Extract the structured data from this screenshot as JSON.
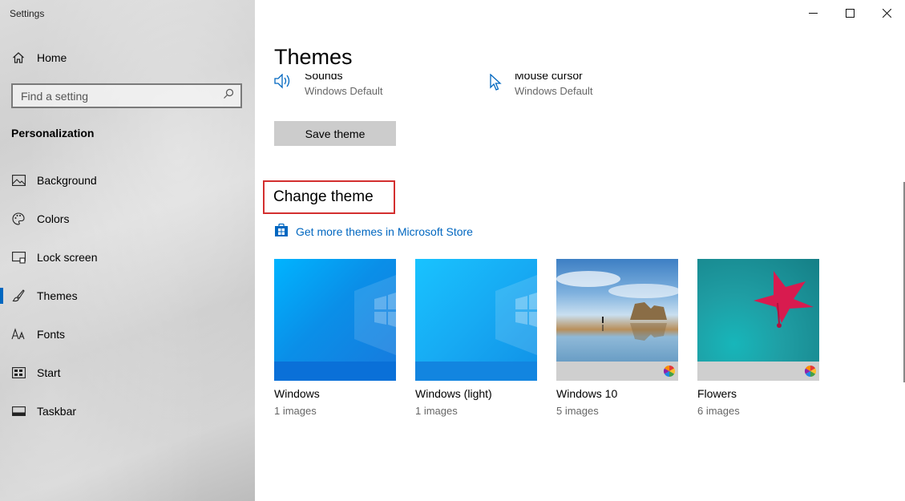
{
  "app": {
    "title": "Settings"
  },
  "sidebar": {
    "home_label": "Home",
    "search_placeholder": "Find a setting",
    "section_title": "Personalization",
    "items": [
      {
        "label": "Background",
        "icon": "picture-icon"
      },
      {
        "label": "Colors",
        "icon": "palette-icon"
      },
      {
        "label": "Lock screen",
        "icon": "lock-screen-icon"
      },
      {
        "label": "Themes",
        "icon": "brush-icon",
        "active": true
      },
      {
        "label": "Fonts",
        "icon": "font-icon"
      },
      {
        "label": "Start",
        "icon": "start-icon"
      },
      {
        "label": "Taskbar",
        "icon": "taskbar-icon"
      }
    ]
  },
  "main": {
    "title": "Themes",
    "properties": [
      {
        "name": "Sounds",
        "value": "Windows Default",
        "icon": "speaker-icon"
      },
      {
        "name": "Mouse cursor",
        "value": "Windows Default",
        "icon": "cursor-icon"
      }
    ],
    "save_button": "Save theme",
    "change_theme_heading": "Change theme",
    "store_link": "Get more themes in Microsoft Store",
    "themes": [
      {
        "name": "Windows",
        "count": "1 images",
        "style": "win-blue",
        "strip": "#0a70d8",
        "colorful": false
      },
      {
        "name": "Windows (light)",
        "count": "1 images",
        "style": "win-light",
        "strip": "#1285e0",
        "colorful": false
      },
      {
        "name": "Windows 10",
        "count": "5 images",
        "style": "beach",
        "strip": "#cfcfcf",
        "colorful": true
      },
      {
        "name": "Flowers",
        "count": "6 images",
        "style": "flowers",
        "strip": "#cfcfcf",
        "colorful": true
      }
    ]
  },
  "colors": {
    "accent": "#0067c0",
    "highlight_border": "#d32f2f"
  }
}
